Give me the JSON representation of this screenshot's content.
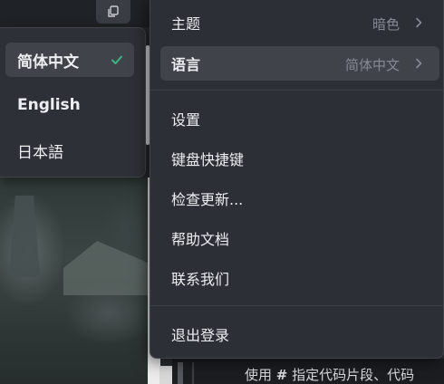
{
  "language_menu": {
    "items": [
      {
        "label": "简体中文",
        "selected": true
      },
      {
        "label": "English",
        "selected": false
      },
      {
        "label": "日本語",
        "selected": false
      }
    ],
    "check_color": "#3fb37f"
  },
  "main_menu": {
    "theme": {
      "label": "主题",
      "value": "暗色"
    },
    "language": {
      "label": "语言",
      "value": "简体中文"
    },
    "settings": {
      "label": "设置"
    },
    "shortcuts": {
      "label": "键盘快捷键"
    },
    "check_updates": {
      "label": "检查更新..."
    },
    "help_docs": {
      "label": "帮助文档"
    },
    "contact_us": {
      "label": "联系我们"
    },
    "logout": {
      "label": "退出登录"
    }
  },
  "background": {
    "hint_prefix": "使用 ",
    "hint_hash": "#",
    "hint_rest": " 指定代码片段、代码"
  },
  "icons": {
    "copy": "copy-icon",
    "check": "check-icon",
    "chevron": "chevron-right-icon"
  }
}
